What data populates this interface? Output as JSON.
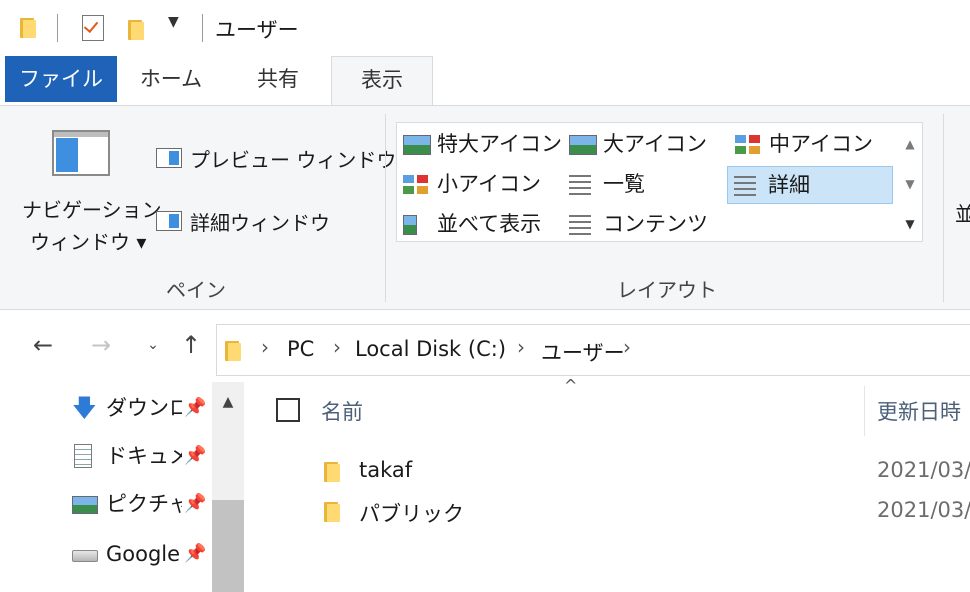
{
  "window": {
    "title": "ユーザー"
  },
  "quick_access_toolbar": {
    "items": [
      "folder-icon",
      "properties-check-icon",
      "new-folder-icon",
      "customize-dropdown-icon"
    ]
  },
  "ribbon": {
    "tabs": [
      {
        "label": "ファイル",
        "active": false
      },
      {
        "label": "ホーム",
        "active": false
      },
      {
        "label": "共有",
        "active": false
      },
      {
        "label": "表示",
        "active": true
      }
    ],
    "pane_group": {
      "label": "ペイン",
      "nav_pane_label_line1": "ナビゲーション",
      "nav_pane_label_line2": "ウィンドウ ▾",
      "preview_pane": "プレビュー ウィンドウ",
      "details_pane": "詳細ウィンドウ"
    },
    "layout_group": {
      "label": "レイアウト",
      "options": [
        "特大アイコン",
        "大アイコン",
        "中アイコン",
        "小アイコン",
        "一覧",
        "詳細",
        "並べて表示",
        "コンテンツ"
      ],
      "selected": "詳細"
    },
    "next_group_partial_label": "並"
  },
  "address_bar": {
    "crumbs": [
      "PC",
      "Local Disk (C:)",
      "ユーザー"
    ]
  },
  "nav_pane": {
    "items": [
      {
        "label": "ダウンロ",
        "icon": "download-arrow-icon",
        "pinned": true
      },
      {
        "label": "ドキュメン",
        "icon": "document-icon",
        "pinned": true
      },
      {
        "label": "ピクチャ",
        "icon": "pictures-icon",
        "pinned": true
      },
      {
        "label": "Google",
        "icon": "drive-icon",
        "pinned": true
      }
    ]
  },
  "file_list": {
    "columns": [
      "名前",
      "更新日時"
    ],
    "sort_indicator": "^",
    "rows": [
      {
        "name": "takaf",
        "modified": "2021/03/"
      },
      {
        "name": "パブリック",
        "modified": "2021/03/"
      }
    ]
  },
  "colors": {
    "file_tab_bg": "#1e63b8",
    "selection_bg": "#cce4f7",
    "folder_yellow": "#ffd972"
  }
}
